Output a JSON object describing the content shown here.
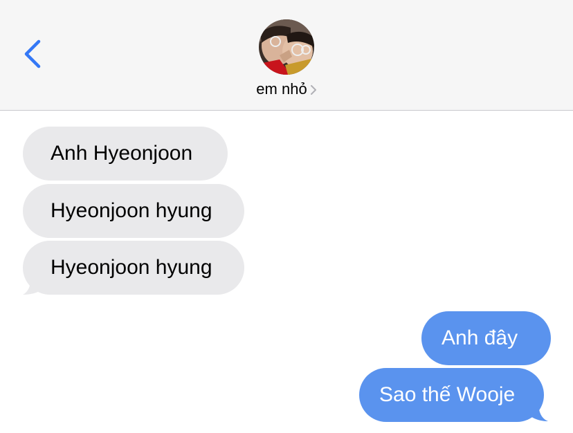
{
  "header": {
    "contact_name": "em nhỏ"
  },
  "messages": {
    "incoming": [
      {
        "text": "Anh Hyeonjoon"
      },
      {
        "text": "Hyeonjoon hyung"
      },
      {
        "text": "Hyeonjoon hyung"
      }
    ],
    "outgoing": [
      {
        "text": "Anh đây"
      },
      {
        "text": "Sao thế Wooje"
      }
    ]
  },
  "colors": {
    "accent": "#3478f6",
    "incoming_bubble": "#e9e9eb",
    "outgoing_bubble": "#5a93ee",
    "header_background": "#f6f6f6"
  }
}
